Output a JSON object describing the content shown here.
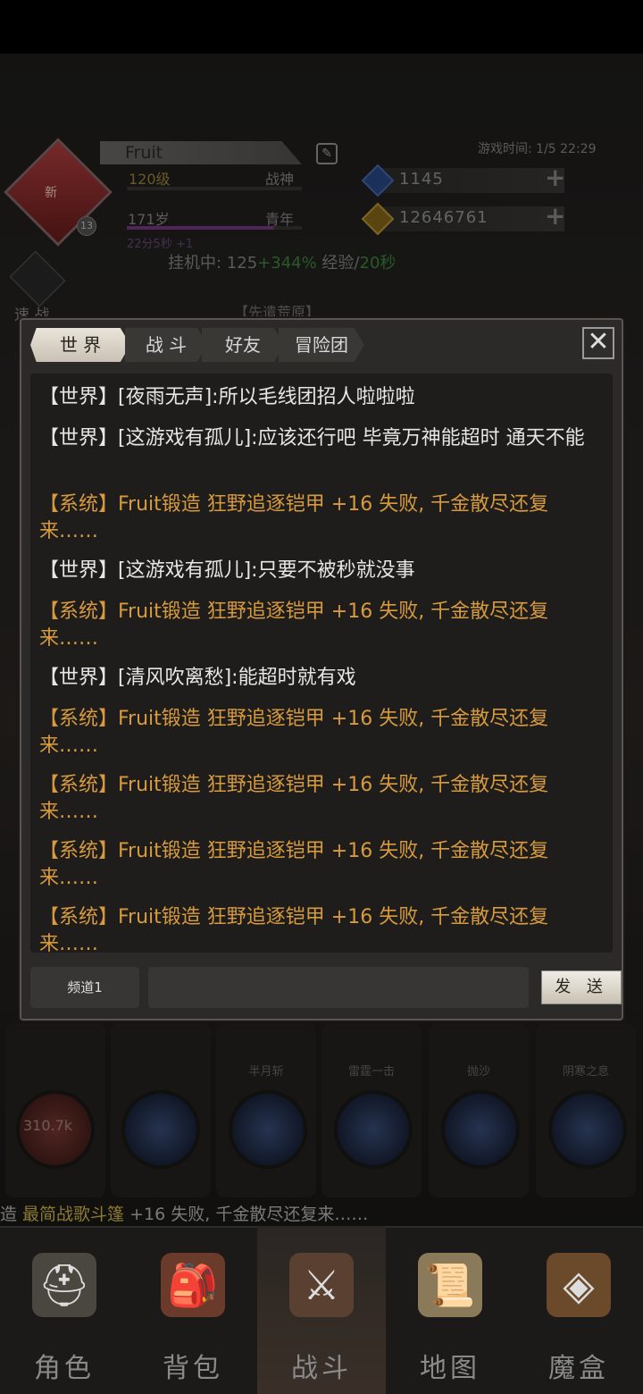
{
  "header": {
    "player_name": "Fruit",
    "level": "120级",
    "rank": "战神",
    "age": "171岁",
    "stage": "青年",
    "lifespan_gain": "22分5秒 +1",
    "level_badge": "13",
    "avatar_tag": "新",
    "game_time": "游戏时间: 1/5 22:29",
    "gems": "1145",
    "gold": "12646761",
    "idle_prefix": "挂机中: 125",
    "idle_bonus": "+344%",
    "idle_mid": " 经验/",
    "idle_time": "20秒",
    "quick_battle": "速 战",
    "map_title": "【先遣荒原】"
  },
  "chat": {
    "tabs": [
      {
        "label": "世 界",
        "active": true
      },
      {
        "label": "战 斗",
        "active": false
      },
      {
        "label": "好友",
        "active": false
      },
      {
        "label": "冒险团",
        "active": false
      }
    ],
    "close_label": "✕",
    "messages": [
      {
        "type": "world",
        "text": "【世界】[夜雨无声]:所以毛线团招人啦啦啦"
      },
      {
        "type": "world",
        "text": "【世界】[这游戏有孤儿]:应该还行吧 毕竟万神能超时 通天不能"
      },
      {
        "type": "sys",
        "text": "【系统】Fruit锻造 狂野追逐铠甲 +16 失败, 千金散尽还复来……"
      },
      {
        "type": "world",
        "text": "【世界】[这游戏有孤儿]:只要不被秒就没事"
      },
      {
        "type": "sys",
        "text": "【系统】Fruit锻造 狂野追逐铠甲 +16 失败, 千金散尽还复来……"
      },
      {
        "type": "world",
        "text": "【世界】[清风吹离愁]:能超时就有戏"
      },
      {
        "type": "sys",
        "text": "【系统】Fruit锻造 狂野追逐铠甲 +16 失败, 千金散尽还复来……"
      },
      {
        "type": "sys",
        "text": "【系统】Fruit锻造 狂野追逐铠甲 +16 失败, 千金散尽还复来……"
      },
      {
        "type": "sys",
        "text": "【系统】Fruit锻造 狂野追逐铠甲 +16 失败, 千金散尽还复来……"
      },
      {
        "type": "sys",
        "text": "【系统】Fruit锻造 狂野追逐铠甲 +16 失败, 千金散尽还复来……"
      }
    ],
    "channel_label": "频道1",
    "input_value": "",
    "send_label": "发 送"
  },
  "skills": {
    "names": [
      "",
      "",
      "半月斩",
      "雷霆一击",
      "抛沙",
      "阴寒之息"
    ],
    "orb_value": "310.7k"
  },
  "ticker": {
    "prefix": "造 ",
    "item": "最简战歌斗篷",
    "suffix": " +16 失败, 千金散尽还复来……"
  },
  "nav": {
    "items": [
      {
        "label": "角色",
        "icon": "helmet-icon"
      },
      {
        "label": "背包",
        "icon": "backpack-icon"
      },
      {
        "label": "战斗",
        "icon": "sword-shield-icon"
      },
      {
        "label": "地图",
        "icon": "scroll-map-icon"
      },
      {
        "label": "魔盒",
        "icon": "magic-box-icon"
      }
    ]
  },
  "colors": {
    "system_text": "#d79a3c",
    "world_text": "#e6e6e6",
    "idle_bonus": "#3e8a3e"
  }
}
